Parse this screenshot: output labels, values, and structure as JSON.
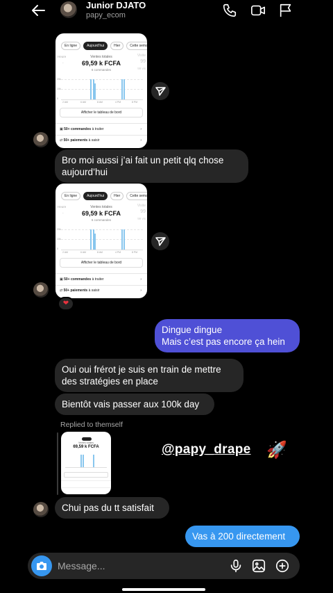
{
  "header": {
    "name": "Junior DJATO",
    "username": "papy_ecom"
  },
  "screenshot": {
    "tabs": [
      "En ligne",
      "Aujourd’hui",
      "Hier",
      "Cette semaine"
    ],
    "active_tab": "Aujourd’hui",
    "left_label": "Heure",
    "left_value": "-",
    "right_label": "Visite",
    "right_value": "99",
    "right_sub": "99 vis",
    "total_label": "Ventes totales",
    "total_value": "69,59 k FCFA",
    "orders": "6 commandes",
    "y_labels": [
      "20k",
      "10k",
      "0"
    ],
    "x_labels": [
      "2 AM",
      "6 AM",
      "8 AM",
      "4 PM",
      "8 PM"
    ],
    "chart_data": {
      "type": "bar",
      "bars_relative": [
        0.95,
        0.95,
        0.75,
        0.95,
        0.95
      ]
    },
    "dashboard_button": "Afficher le tableau de bord",
    "row1_bold": "50+ commandes",
    "row1_rest": " à traiter",
    "row2_bold": "50+ paiements",
    "row2_rest": " à saisir"
  },
  "messages": {
    "m1": "Bro moi aussi j’ai fait un petit qlq chose aujourd’hui",
    "reaction": "❤",
    "m2_line1": "Dingue dingue",
    "m2_line2": "Mais c’est pas encore ça hein",
    "m3_line1": "Oui oui frérot je suis en train de mettre",
    "m3_line2": "des stratégies en place",
    "m4": "Bientôt vais passer aux 100k day",
    "replied": "Replied to themself",
    "mention": "@papy_drape",
    "rocket": "🚀",
    "m5": "Chui pas du tt satisfait",
    "m6": "Vas à 200 directement"
  },
  "composer": {
    "placeholder": "Message..."
  },
  "colors": {
    "incoming": "#262626",
    "outgoing_purple": "#4f50d6",
    "outgoing_blue": "#3797f0",
    "camera": "#3797f0"
  }
}
